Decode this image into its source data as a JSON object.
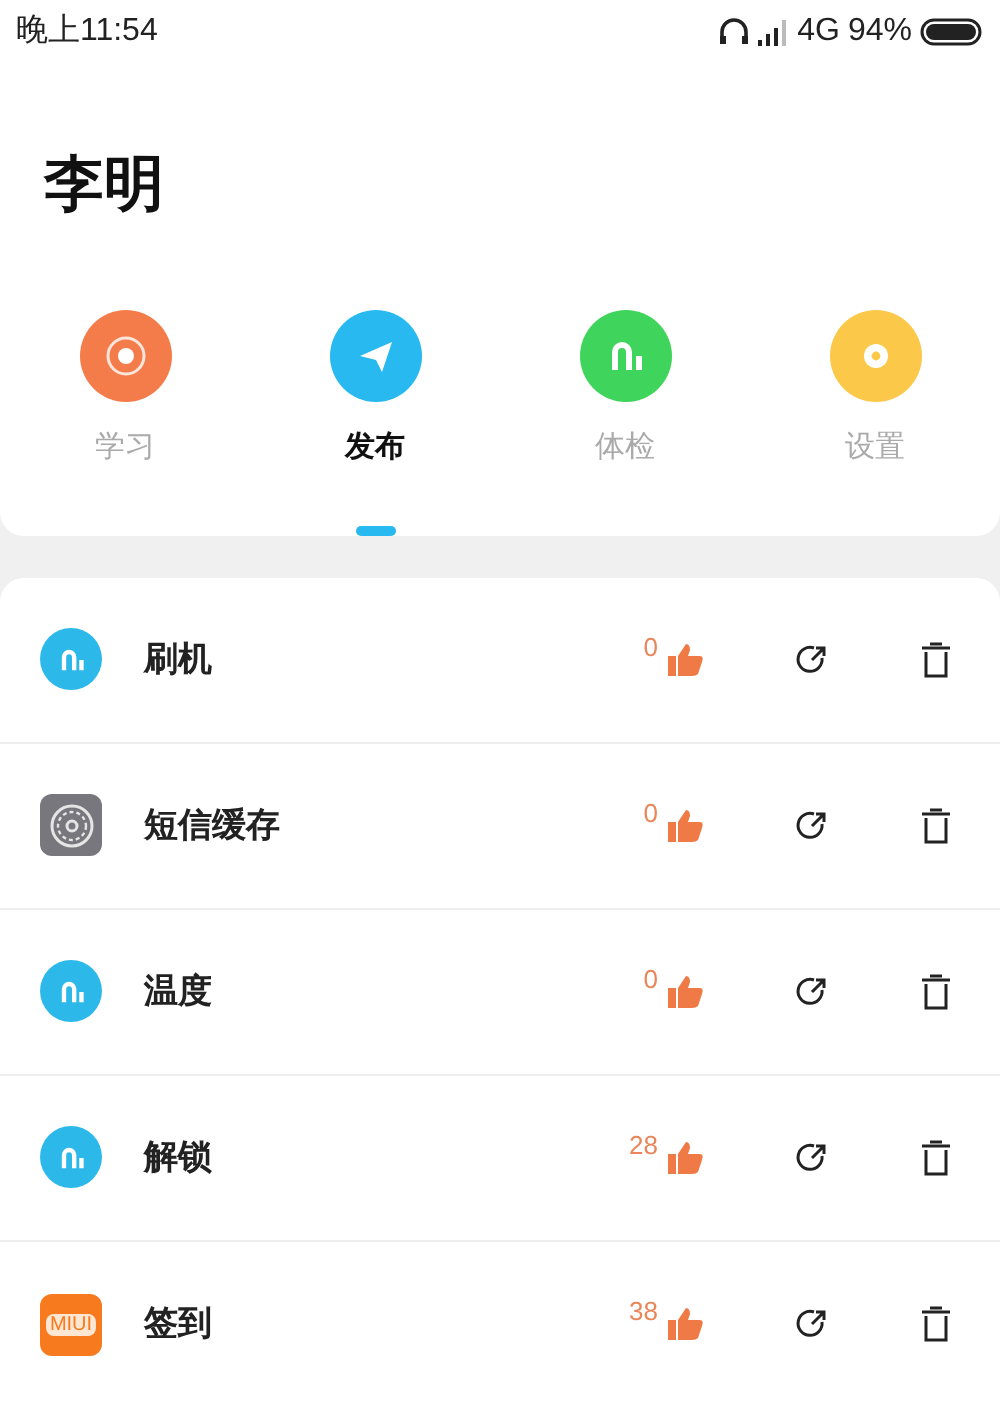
{
  "status_bar": {
    "time": "晚上11:54",
    "network": "4G",
    "battery": "94%"
  },
  "profile": {
    "name": "李明"
  },
  "tabs": [
    {
      "label": "学习",
      "kind": "target",
      "color": "#f47c4a",
      "selected": false
    },
    {
      "label": "发布",
      "kind": "plane",
      "color": "#27b9ef",
      "selected": true
    },
    {
      "label": "体检",
      "kind": "mi",
      "color": "#3fd45b",
      "selected": false
    },
    {
      "label": "设置",
      "kind": "gear",
      "color": "#fcc84a",
      "selected": false
    }
  ],
  "items": [
    {
      "name": "刷机",
      "kind": "mi",
      "likes": "0"
    },
    {
      "name": "短信缓存",
      "kind": "gear",
      "likes": "0"
    },
    {
      "name": "温度",
      "kind": "mi",
      "likes": "0"
    },
    {
      "name": "解锁",
      "kind": "mi",
      "likes": "28"
    },
    {
      "name": "签到",
      "kind": "miui",
      "icon_text": "MIUI",
      "likes": "38"
    }
  ]
}
